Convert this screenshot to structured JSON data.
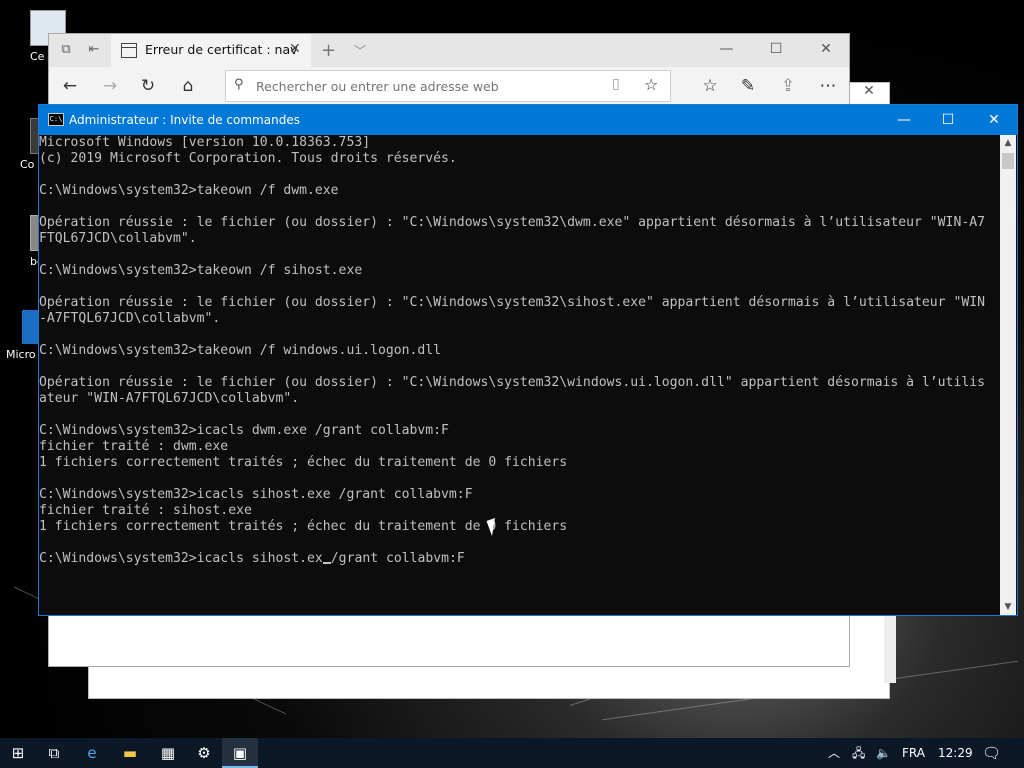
{
  "desktop": {
    "icons": [
      {
        "label": "Ce",
        "icon": "this-pc-icon"
      },
      {
        "label": "Co",
        "icon": "control-panel-icon"
      },
      {
        "label": "bo",
        "icon": "bin-icon"
      },
      {
        "label": "Micro",
        "icon": "edge-icon"
      }
    ]
  },
  "edge": {
    "tab_title": "Erreur de certificat : nav",
    "address_placeholder": "Rechercher ou entrer une adresse web"
  },
  "cmd": {
    "title": "Administrateur : Invite de commandes",
    "lines": [
      "Microsoft Windows [version 10.0.18363.753]",
      "(c) 2019 Microsoft Corporation. Tous droits réservés.",
      "",
      "C:\\Windows\\system32>takeown /f dwm.exe",
      "",
      "Opération réussie : le fichier (ou dossier) : \"C:\\Windows\\system32\\dwm.exe\" appartient désormais à l’utilisateur \"WIN-A7",
      "FTQL67JCD\\collabvm\".",
      "",
      "C:\\Windows\\system32>takeown /f sihost.exe",
      "",
      "Opération réussie : le fichier (ou dossier) : \"C:\\Windows\\system32\\sihost.exe\" appartient désormais à l’utilisateur \"WIN",
      "-A7FTQL67JCD\\collabvm\".",
      "",
      "C:\\Windows\\system32>takeown /f windows.ui.logon.dll",
      "",
      "Opération réussie : le fichier (ou dossier) : \"C:\\Windows\\system32\\windows.ui.logon.dll\" appartient désormais à l’utilis",
      "ateur \"WIN-A7FTQL67JCD\\collabvm\".",
      "",
      "C:\\Windows\\system32>icacls dwm.exe /grant collabvm:F",
      "fichier traité : dwm.exe",
      "1 fichiers correctement traités ; échec du traitement de 0 fichiers",
      "",
      "C:\\Windows\\system32>icacls sihost.exe /grant collabvm:F",
      "fichier traité : sihost.exe",
      "1 fichiers correctement traités ; échec du traitement de 0 fichiers",
      ""
    ],
    "current_prompt": "C:\\Windows\\system32>icacls sihost.ex",
    "current_input_rest": "/grant collabvm:F"
  },
  "taskbar": {
    "language": "FRA",
    "time": "12:29"
  }
}
